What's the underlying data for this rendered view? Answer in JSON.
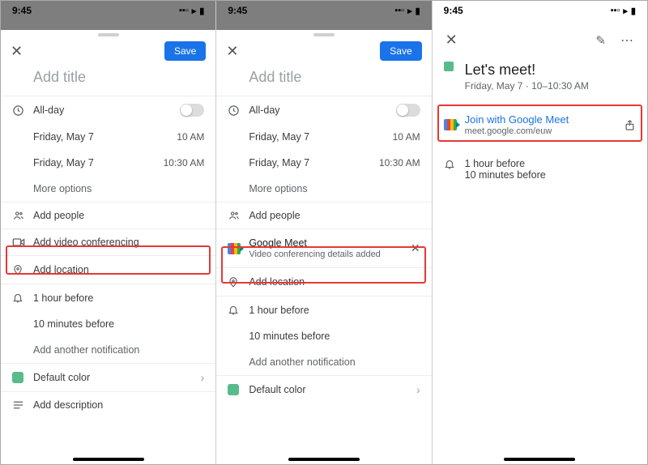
{
  "status": {
    "time": "9:45"
  },
  "save_label": "Save",
  "title_placeholder": "Add title",
  "allday": "All-day",
  "date": "Friday, May 7",
  "start": "10 AM",
  "end": "10:30 AM",
  "more_options": "More options",
  "add_people": "Add people",
  "add_video": "Add video conferencing",
  "google_meet": "Google Meet",
  "video_added": "Video conferencing details added",
  "add_location": "Add location",
  "notif1": "1 hour before",
  "notif2": "10 minutes before",
  "add_notif": "Add another notification",
  "default_color": "Default color",
  "add_desc": "Add description",
  "event": {
    "title": "Let's meet!",
    "when": "Friday, May 7 · 10–10:30 AM",
    "join": "Join with Google Meet",
    "url": "meet.google.com/euw"
  }
}
